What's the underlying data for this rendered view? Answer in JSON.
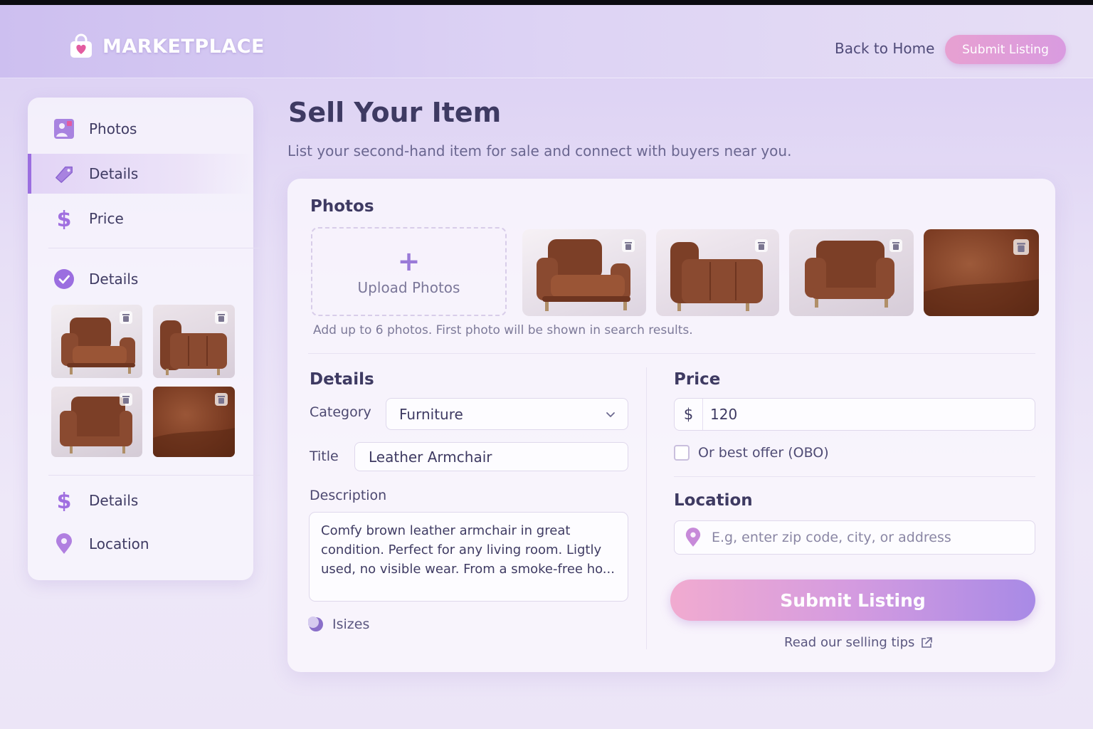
{
  "header": {
    "brand": "MARKETPLACE",
    "back_link": "Back to Home",
    "submit_label": "Submit Listing"
  },
  "sidebar": {
    "items": [
      {
        "label": "Photos",
        "icon": "image-icon"
      },
      {
        "label": "Details",
        "icon": "tag-icon",
        "active": true
      },
      {
        "label": "Price",
        "icon": "dollar-icon"
      },
      {
        "label": "Details",
        "icon": "check-circle-icon"
      },
      {
        "label": "Details",
        "icon": "dollar-icon"
      },
      {
        "label": "Location",
        "icon": "map-pin-icon"
      }
    ]
  },
  "main": {
    "title": "Sell Your Item",
    "subtitle": "List your second-hand item for sale and connect with buyers near you.",
    "photos": {
      "heading": "Photos",
      "upload_label": "Upload Photos",
      "helper": "Add up to 6 photos. First photo will be shown in search results."
    },
    "details": {
      "heading": "Details",
      "category_label": "Category",
      "category_value": "Furniture",
      "title_label": "Title",
      "title_value": "Leather Armchair",
      "description_label": "Description",
      "description_value": "Comfy brown leather armchair in great condition. Perfect for any living room. Ligtly used, no visible wear. From a smoke-free ho...",
      "sizes_label": "Isizes"
    },
    "price": {
      "heading": "Price",
      "currency": "$",
      "value": "120",
      "obo_label": "Or best offer (OBO)",
      "obo_checked": false
    },
    "location": {
      "heading": "Location",
      "placeholder": "E.g, enter zip code, city, or address"
    },
    "submit_label": "Submit Listing",
    "tips_link": "Read our selling tips"
  },
  "colors": {
    "accent": "#9b6ee0",
    "leather": "#8a4a30",
    "pink": "#e7a0d1"
  }
}
